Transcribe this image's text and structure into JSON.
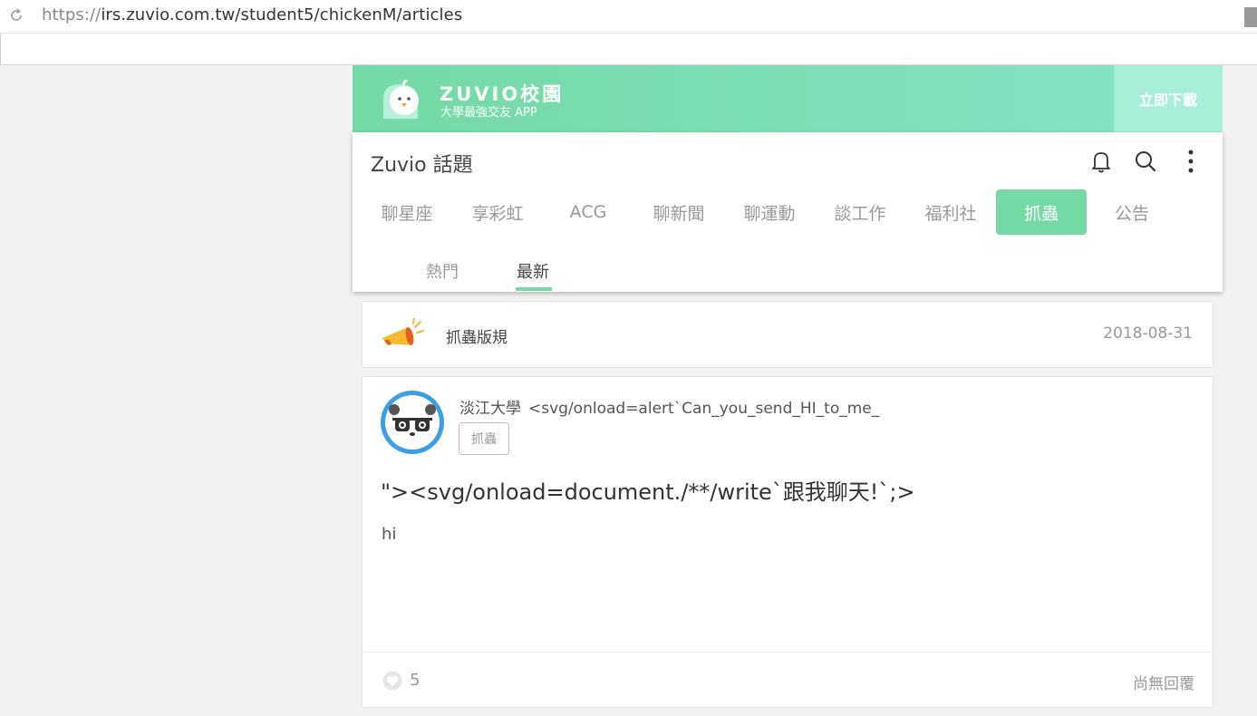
{
  "browser": {
    "url_scheme": "https://",
    "url_rest": "irs.zuvio.com.tw/student5/chickenM/articles"
  },
  "banner": {
    "brand": "ZUVIO校園",
    "tagline": "大學最強交友 APP",
    "download_label": "立即下載"
  },
  "header": {
    "title": "Zuvio 話題",
    "icons": [
      "bell-icon",
      "search-icon",
      "more-vertical-icon"
    ],
    "tabs": [
      {
        "label": "聊星座"
      },
      {
        "label": "享彩虹"
      },
      {
        "label": "ACG"
      },
      {
        "label": "聊新聞"
      },
      {
        "label": "聊運動"
      },
      {
        "label": "談工作"
      },
      {
        "label": "福利社"
      },
      {
        "label": "抓蟲"
      },
      {
        "label": "公告"
      }
    ],
    "active_tab": "抓蟲",
    "subtabs": [
      {
        "label": "熱門"
      },
      {
        "label": "最新"
      }
    ],
    "active_subtab": "最新"
  },
  "notice": {
    "title": "抓蟲版規",
    "date": "2018-08-31"
  },
  "post": {
    "school": "淡江大學",
    "username": "<svg/onload=alert`Can_you_send_HI_to_me_",
    "board": "抓蟲",
    "title": "\"><svg/onload=document./**/write`跟我聊天!`;>",
    "body": "hi",
    "likes": "5",
    "reply_status": "尚無回覆"
  },
  "colors": {
    "accent": "#74d9a5",
    "banner_end": "#86e3c6"
  }
}
